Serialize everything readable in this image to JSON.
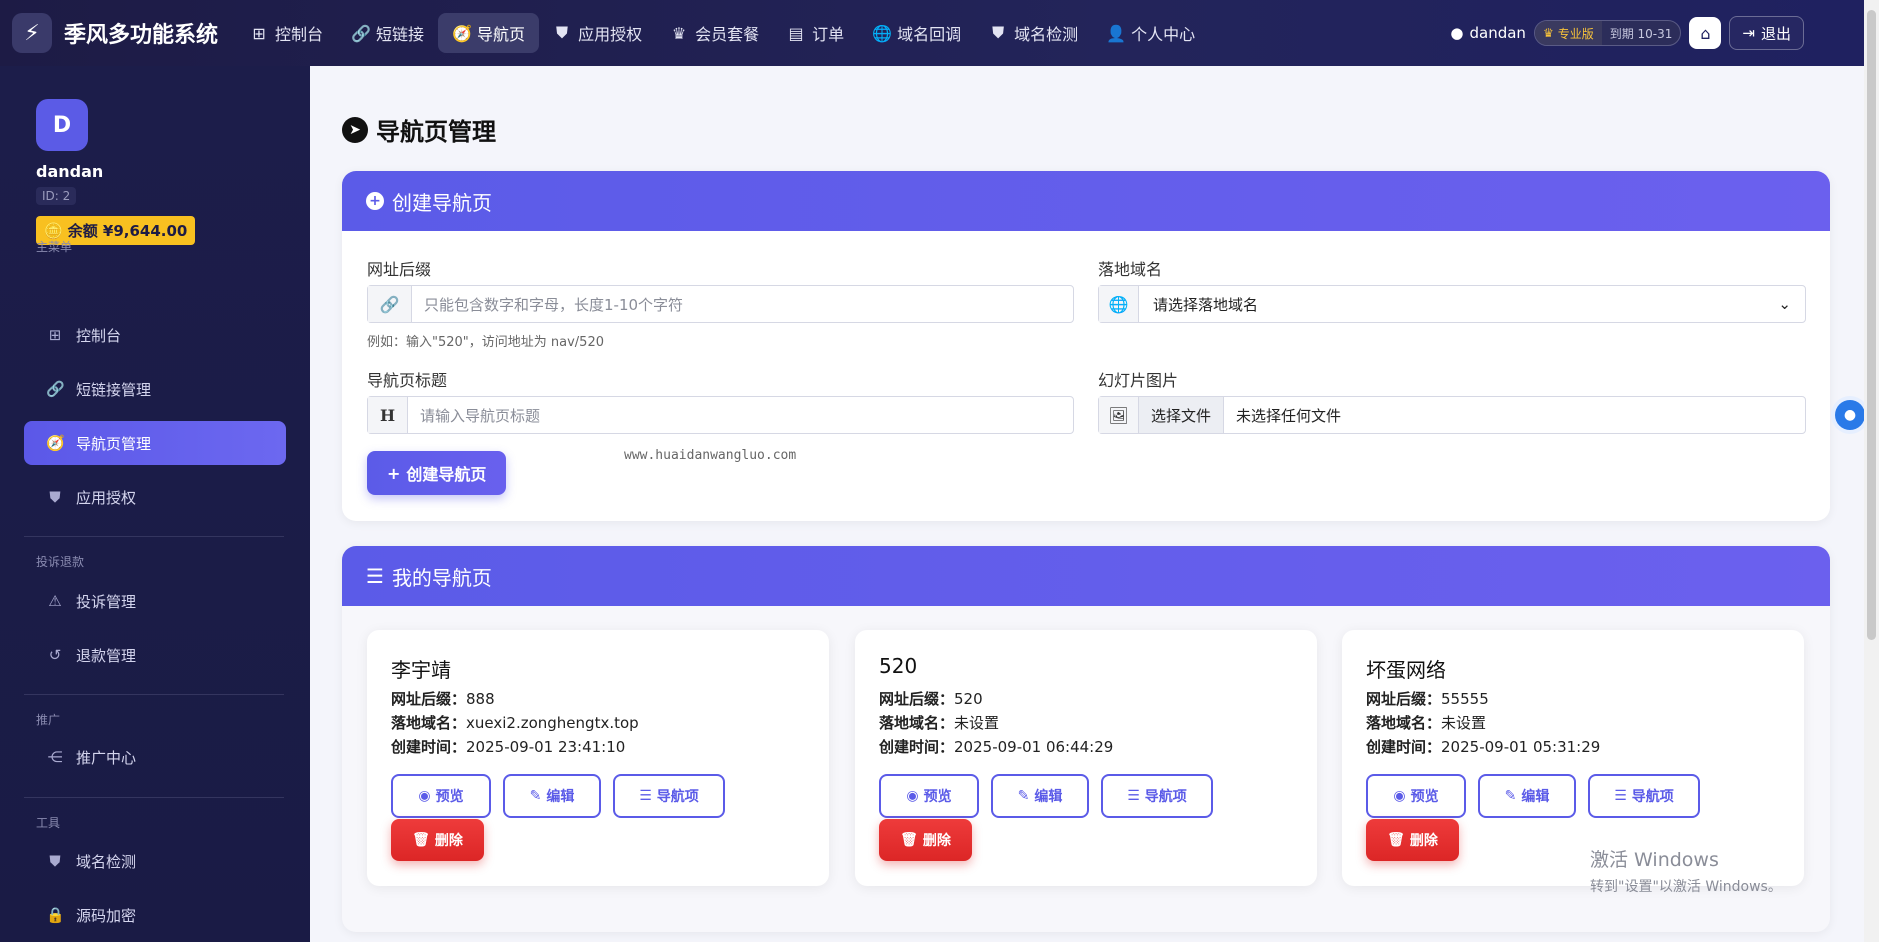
{
  "brand": {
    "name": "季风多功能系统",
    "icon": "bolt-icon"
  },
  "topnav": [
    {
      "label": "控制台",
      "icon": "grid-icon"
    },
    {
      "label": "短链接",
      "icon": "link-icon"
    },
    {
      "label": "导航页",
      "icon": "compass-icon",
      "active": true
    },
    {
      "label": "应用授权",
      "icon": "shield-icon"
    },
    {
      "label": "会员套餐",
      "icon": "crown-icon"
    },
    {
      "label": "订单",
      "icon": "receipt-icon"
    },
    {
      "label": "域名回调",
      "icon": "globe-icon"
    },
    {
      "label": "域名检测",
      "icon": "shield-icon"
    },
    {
      "label": "个人中心",
      "icon": "user-icon"
    }
  ],
  "user": {
    "name": "dandan",
    "plan": "专业版",
    "expires": "到期 10-31",
    "logout": "退出"
  },
  "sidebar": {
    "avatar_letter": "D",
    "username": "dandan",
    "user_id": "ID: 2",
    "balance": "余额 ¥9,644.00",
    "sections": {
      "main": "主菜单",
      "complaint": "投诉退款",
      "promo": "推广",
      "tools": "工具"
    },
    "items": [
      {
        "label": "控制台",
        "icon": "grid-icon"
      },
      {
        "label": "短链接管理",
        "icon": "link-icon"
      },
      {
        "label": "导航页管理",
        "icon": "compass-icon",
        "active": true
      },
      {
        "label": "应用授权",
        "icon": "shield-icon"
      },
      {
        "label": "投诉管理",
        "icon": "warning-icon"
      },
      {
        "label": "退款管理",
        "icon": "undo-icon"
      },
      {
        "label": "推广中心",
        "icon": "share-icon"
      },
      {
        "label": "域名检测",
        "icon": "shield-icon"
      },
      {
        "label": "源码加密",
        "icon": "lock-icon"
      }
    ]
  },
  "page": {
    "title": "导航页管理"
  },
  "create": {
    "header": "创建导航页",
    "suffix_label": "网址后缀",
    "suffix_placeholder": "只能包含数字和字母，长度1-10个字符",
    "suffix_hint": "例如：输入\"520\"，访问地址为 nav/520",
    "domain_label": "落地域名",
    "domain_value": "请选择落地域名",
    "title_label": "导航页标题",
    "title_placeholder": "请输入导航页标题",
    "slide_label": "幻灯片图片",
    "file_button": "选择文件",
    "file_status": "未选择任何文件",
    "submit": "创建导航页",
    "watermark": "www.huaidanwangluo.com"
  },
  "list": {
    "header": "我的导航页",
    "field_suffix": "网址后缀：",
    "field_domain": "落地域名：",
    "field_created": "创建时间：",
    "btn_preview": "预览",
    "btn_edit": "编辑",
    "btn_items": "导航项",
    "btn_delete": "删除",
    "cards": [
      {
        "title": "李宇靖",
        "suffix": "888",
        "domain": "xuexi2.zonghengtx.top",
        "created": "2025-09-01 23:41:10"
      },
      {
        "title": "520",
        "suffix": "520",
        "domain": "未设置",
        "created": "2025-09-01 06:44:29"
      },
      {
        "title": "坏蛋网络",
        "suffix": "55555",
        "domain": "未设置",
        "created": "2025-09-01 05:31:29"
      }
    ]
  },
  "windows": {
    "line1": "激活 Windows",
    "line2": "转到\"设置\"以激活 Windows。"
  }
}
